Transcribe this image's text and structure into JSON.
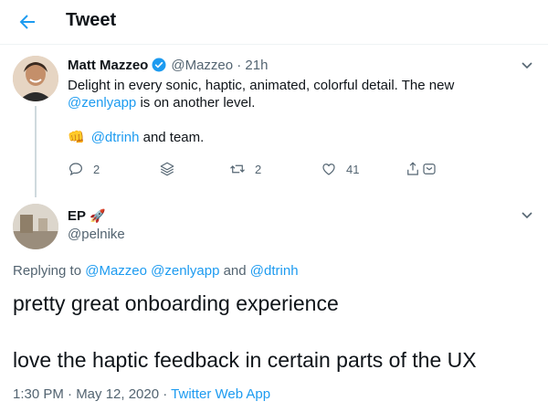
{
  "header": {
    "title": "Tweet"
  },
  "colors": {
    "accent": "#1d9bf0",
    "muted": "#536471",
    "text": "#0f1419"
  },
  "icons": [
    "back-arrow-icon",
    "verified-badge-icon",
    "chevron-down-icon",
    "reply-icon",
    "stack-icon",
    "retweet-icon",
    "like-icon",
    "share-icon",
    "fist-emoji",
    "rocket-emoji"
  ],
  "tweet1": {
    "name": "Matt Mazzeo",
    "handle_time": "@Mazzeo · 21h",
    "line1": "Delight in every sonic, haptic, animated, colorful detail. The new",
    "line2_link": "@zenlyapp",
    "line2_rest": " is on another level.",
    "line3_emoji": "👊",
    "line3_link": "@dtrinh",
    "line3_rest": " and team.",
    "actions": {
      "reply_count": "2",
      "retweet_count": "2",
      "like_count": "41"
    }
  },
  "tweet2": {
    "name": "EP",
    "name_emoji": "🚀",
    "handle": "@pelnike",
    "replying_prefix": "Replying to ",
    "replying_1": "@Mazzeo",
    "replying_2": "@zenlyapp",
    "replying_and": " and ",
    "replying_3": "@dtrinh",
    "text_line1": "pretty great onboarding experience",
    "text_line2": "love the haptic feedback in certain parts of the UX",
    "timestamp": "1:30 PM · May 12, 2020 · ",
    "source": "Twitter Web App"
  }
}
